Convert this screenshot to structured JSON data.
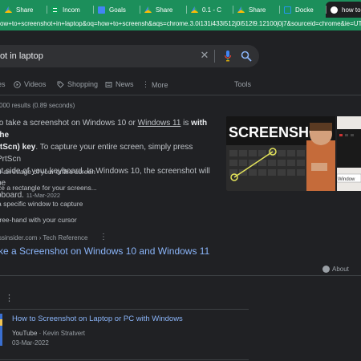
{
  "browser": {
    "tabs": [
      {
        "label": "Share",
        "icon": "drive-icon"
      },
      {
        "label": "Incom",
        "icon": "sheets-icon"
      },
      {
        "label": "Goals",
        "icon": "docs-icon"
      },
      {
        "label": "Share",
        "icon": "drive-icon"
      },
      {
        "label": "0.1 - C",
        "icon": "drive-icon"
      },
      {
        "label": "Share",
        "icon": "drive-icon"
      },
      {
        "label": "Docke",
        "icon": "docker-icon"
      },
      {
        "label": "how to",
        "icon": "google-icon"
      }
    ],
    "url": "ow+to+screenshot+in+laptop&oq=how+to+screensh&aqs=chrome.3.0i131i433i512j0i512l9.12100j0j7&sourceid=chrome&ie=UTF-8"
  },
  "search": {
    "query": "ot in laptop"
  },
  "search_tabs": {
    "items": [
      {
        "label": "es",
        "icon": ""
      },
      {
        "label": "Videos",
        "icon": "play-icon"
      },
      {
        "label": "Shopping",
        "icon": "tag-icon"
      },
      {
        "label": "News",
        "icon": "news-icon"
      },
      {
        "label": "More",
        "icon": "more-dots-icon"
      }
    ],
    "tools": "Tools"
  },
  "results_stats": "000 results (0.89 seconds)",
  "snippet": {
    "line1_a": "to take a screenshot on Windows 10 or ",
    "line1_link": "Windows 11",
    "line1_b": " is ",
    "line1_bold": "with the",
    "line2_bold": "rtScn) key",
    "line2_rest": ". To capture your entire screen, simply press PrtScn",
    "line3": "ht side of your keyboard. In Windows 10, the screenshot will be",
    "line4": "pboard.",
    "date": "11-Mar-2022"
  },
  "steps": [
    "b an image of your entire screen",
    "ze a rectangle for your screens...",
    "a specific window to capture",
    "free-hand with your cursor"
  ],
  "source": {
    "site": "ssinsider.com",
    "path": " › Tech Reference"
  },
  "result_title": "ke a Screenshot on Windows 10 and Windows 11",
  "featured_image": {
    "headline": "SCREENSHOT",
    "side_label": "Window"
  },
  "about_label": "About",
  "video": {
    "title": "How to Screenshot on Laptop or PC with Windows",
    "platform": "YouTube",
    "channel": "Kevin Stratvert",
    "date": "03-Mar-2022"
  },
  "colors": {
    "tab_strip": "#1c8f5b",
    "page_bg": "#202124",
    "link": "#8ab4f8",
    "text": "#bdc1c6"
  }
}
